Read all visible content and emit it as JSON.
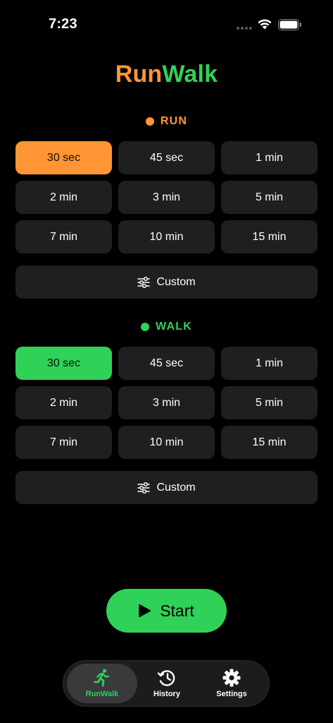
{
  "status": {
    "time": "7:23"
  },
  "app": {
    "title_run": "Run",
    "title_walk": "Walk"
  },
  "run_section": {
    "label": "RUN",
    "color": "#ff9533",
    "options": [
      "30 sec",
      "45 sec",
      "1 min",
      "2 min",
      "3 min",
      "5 min",
      "7 min",
      "10 min",
      "15 min"
    ],
    "selected": "30 sec",
    "custom_label": "Custom"
  },
  "walk_section": {
    "label": "WALK",
    "color": "#30d158",
    "options": [
      "30 sec",
      "45 sec",
      "1 min",
      "2 min",
      "3 min",
      "5 min",
      "7 min",
      "10 min",
      "15 min"
    ],
    "selected": "30 sec",
    "custom_label": "Custom"
  },
  "start_button": {
    "label": "Start",
    "icon": "play-icon"
  },
  "tab_bar": {
    "tabs": [
      {
        "label": "RunWalk",
        "icon": "running-figure-icon",
        "active": true
      },
      {
        "label": "History",
        "icon": "clock-history-icon",
        "active": false
      },
      {
        "label": "Settings",
        "icon": "gear-icon",
        "active": false
      }
    ]
  }
}
